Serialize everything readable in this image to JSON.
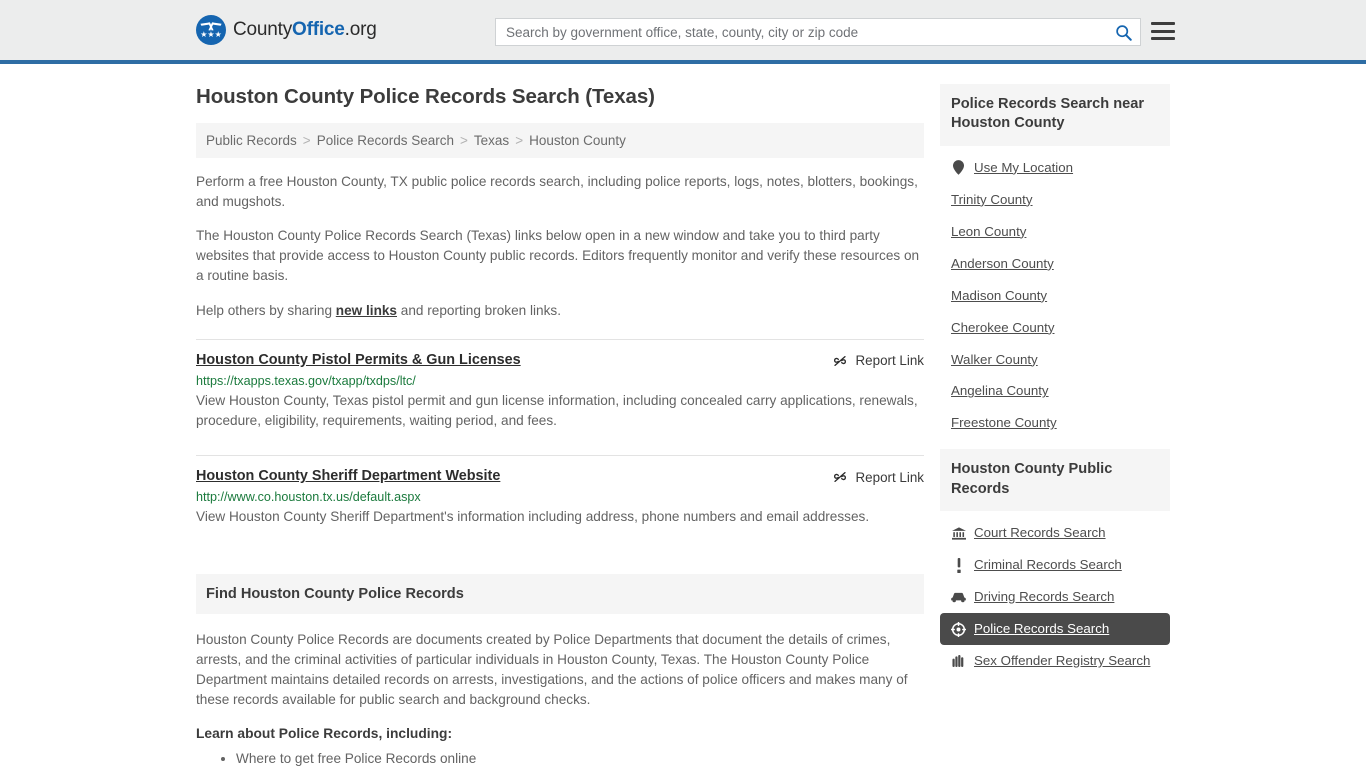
{
  "header": {
    "brand": {
      "part1": "County",
      "part2": "Office",
      "part3": ".org",
      "stars": "★★★"
    },
    "search": {
      "placeholder": "Search by government office, state, county, city or zip code",
      "value": "",
      "button_icon": "search-icon"
    },
    "menu_icon": "hamburger-menu-icon",
    "accent_color": "#2e6da4"
  },
  "main": {
    "title": "Houston County Police Records Search (Texas)",
    "breadcrumb": {
      "separator": ">",
      "items": [
        {
          "label": "Public Records",
          "link": true
        },
        {
          "label": "Police Records Search",
          "link": true
        },
        {
          "label": "Texas",
          "link": true
        },
        {
          "label": "Houston County",
          "link": false
        }
      ]
    },
    "intro_paragraphs": [
      "Perform a free Houston County, TX public police records search, including police reports, logs, notes, blotters, bookings, and mugshots.",
      "The Houston County Police Records Search (Texas) links below open in a new window and take you to third party websites that provide access to Houston County public records. Editors frequently monitor and verify these resources on a routine basis."
    ],
    "share_line": {
      "before": "Help others by sharing ",
      "link": "new links",
      "after": " and reporting broken links."
    },
    "report_link_label": "Report Link",
    "report_link_icon": "broken-link-icon",
    "results": [
      {
        "title": "Houston County Pistol Permits & Gun Licenses",
        "url": "https://txapps.texas.gov/txapp/txdps/ltc/",
        "description": "View Houston County, Texas pistol permit and gun license information, including concealed carry applications, renewals, procedure, eligibility, requirements, waiting period, and fees."
      },
      {
        "title": "Houston County Sheriff Department Website",
        "url": "http://www.co.houston.tx.us/default.aspx",
        "description": "View Houston County Sheriff Department's information including address, phone numbers and email addresses."
      }
    ],
    "section": {
      "heading": "Find Houston County Police Records",
      "paragraph": "Houston County Police Records are documents created by Police Departments that document the details of crimes, arrests, and the criminal activities of particular individuals in Houston County, Texas. The Houston County Police Department maintains detailed records on arrests, investigations, and the actions of police officers and makes many of these records available for public search and background checks.",
      "learn_label": "Learn about Police Records, including:",
      "bullets": [
        "Where to get free Police Records online"
      ]
    }
  },
  "sidebar": {
    "nearby": {
      "heading": "Police Records Search near Houston County",
      "items": [
        {
          "label": "Use My Location",
          "icon": "map-pin-icon",
          "active": false
        },
        {
          "label": "Trinity County",
          "icon": "",
          "active": false
        },
        {
          "label": "Leon County",
          "icon": "",
          "active": false
        },
        {
          "label": "Anderson County",
          "icon": "",
          "active": false
        },
        {
          "label": "Madison County",
          "icon": "",
          "active": false
        },
        {
          "label": "Cherokee County",
          "icon": "",
          "active": false
        },
        {
          "label": "Walker County",
          "icon": "",
          "active": false
        },
        {
          "label": "Angelina County",
          "icon": "",
          "active": false
        },
        {
          "label": "Freestone County",
          "icon": "",
          "active": false
        }
      ]
    },
    "public_records": {
      "heading": "Houston County Public Records",
      "items": [
        {
          "label": "Court Records Search",
          "icon": "courthouse-icon",
          "active": false
        },
        {
          "label": "Criminal Records Search",
          "icon": "exclamation-icon",
          "active": false
        },
        {
          "label": "Driving Records Search",
          "icon": "car-icon",
          "active": false
        },
        {
          "label": "Police Records Search",
          "icon": "police-badge-icon",
          "active": true
        },
        {
          "label": "Sex Offender Registry Search",
          "icon": "fingerprint-icon",
          "active": false
        }
      ]
    }
  }
}
